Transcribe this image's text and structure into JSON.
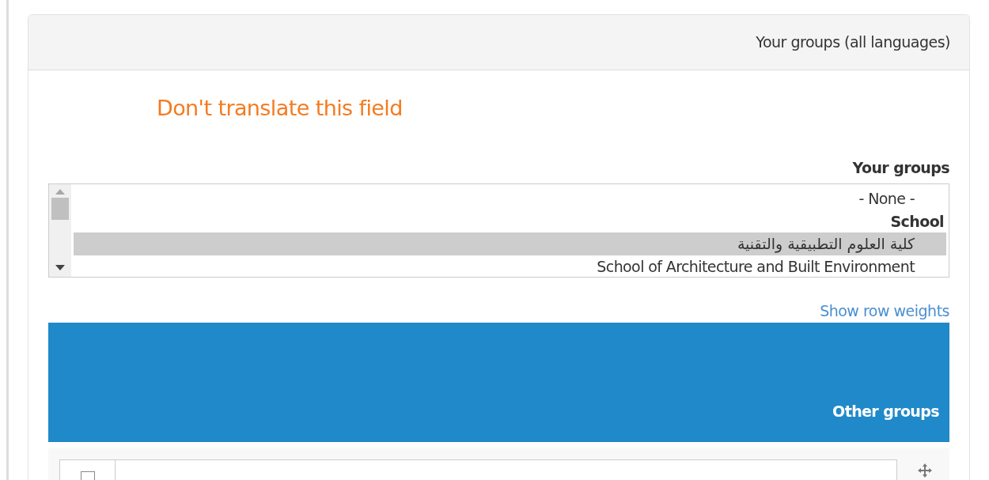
{
  "panel": {
    "title": "Your groups (all languages)"
  },
  "notice": "Don't translate this field",
  "groups_field": {
    "label": "Your groups",
    "options": [
      {
        "text": "- None -",
        "kind": "option",
        "selected": false
      },
      {
        "text": "School",
        "kind": "group",
        "selected": false
      },
      {
        "text": "كلية العلوم التطبيقية والتقنية",
        "kind": "option",
        "selected": true
      },
      {
        "text": "School of Architecture and Built Environment",
        "kind": "option",
        "selected": false
      }
    ]
  },
  "weights_link": "Show row weights",
  "other_groups": {
    "title": "Other groups",
    "rows": [
      {
        "checked": false
      }
    ]
  }
}
